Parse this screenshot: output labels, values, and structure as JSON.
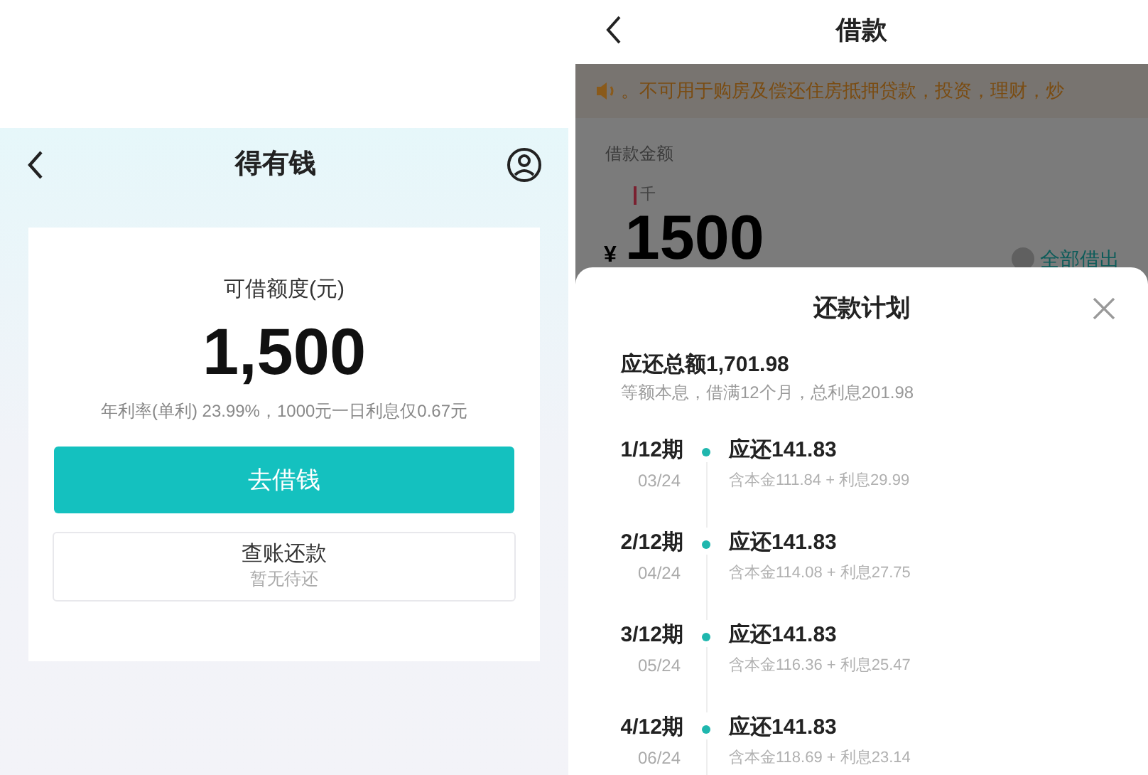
{
  "left_screen": {
    "title": "得有钱",
    "credit_label": "可借额度(元)",
    "credit_amount": "1,500",
    "rate_note": "年利率(单利) 23.99%，1000元一日利息仅0.67元",
    "borrow_button": "去借钱",
    "bill_button": {
      "label": "查账还款",
      "sublabel": "暂无待还"
    }
  },
  "right_screen": {
    "title": "借款",
    "notice": "。不可用于购房及偿还住房抵押贷款，投资，理财，炒",
    "amount_label": "借款金额",
    "amount_hint": "千",
    "currency": "¥",
    "amount": "1500",
    "borrow_all": "全部借出",
    "plan_sheet": {
      "title": "还款计划",
      "total": "应还总额1,701.98",
      "summary": "等额本息，借满12个月，总利息201.98",
      "installments": [
        {
          "period": "1/12期",
          "date": "03/24",
          "amount": "应还141.83",
          "breakdown": "含本金111.84 + 利息29.99"
        },
        {
          "period": "2/12期",
          "date": "04/24",
          "amount": "应还141.83",
          "breakdown": "含本金114.08 + 利息27.75"
        },
        {
          "period": "3/12期",
          "date": "05/24",
          "amount": "应还141.83",
          "breakdown": "含本金116.36 + 利息25.47"
        },
        {
          "period": "4/12期",
          "date": "06/24",
          "amount": "应还141.83",
          "breakdown": "含本金118.69 + 利息23.14"
        }
      ]
    }
  }
}
